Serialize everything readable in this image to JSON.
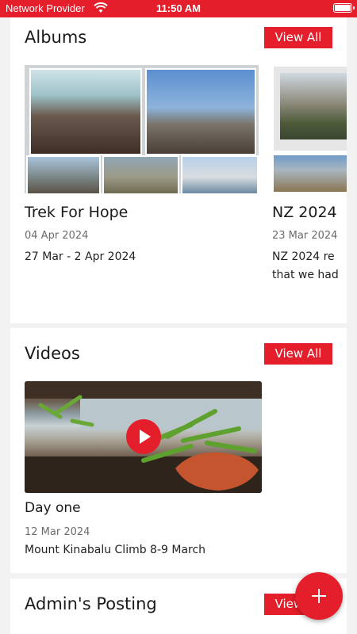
{
  "status_bar": {
    "carrier": "Network Provider",
    "time": "11:50 AM",
    "wifi_icon": "wifi-icon",
    "battery_icon": "battery-icon"
  },
  "albums": {
    "title": "Albums",
    "view_all": "View All",
    "items": [
      {
        "title": "Trek For Hope",
        "date": "04 Apr 2024",
        "description": "27 Mar - 2 Apr 2024"
      },
      {
        "title": "NZ 2024",
        "date": "23 Mar 2024",
        "description": "NZ 2024 re",
        "description_line2": "that we had"
      }
    ]
  },
  "videos": {
    "title": "Videos",
    "view_all": "View All",
    "items": [
      {
        "title": "Day one",
        "date": "12 Mar 2024",
        "description": "Mount Kinabalu Climb 8-9 March",
        "play_icon": "play-icon"
      }
    ]
  },
  "admin_posting": {
    "title": "Admin's Posting",
    "view_all": "View All"
  },
  "fab": {
    "icon": "plus-icon"
  },
  "colors": {
    "accent": "#e41e2b",
    "background": "#f2f2f2",
    "card": "#ffffff",
    "text": "#1a1a1a",
    "muted": "#6b6b6b"
  }
}
